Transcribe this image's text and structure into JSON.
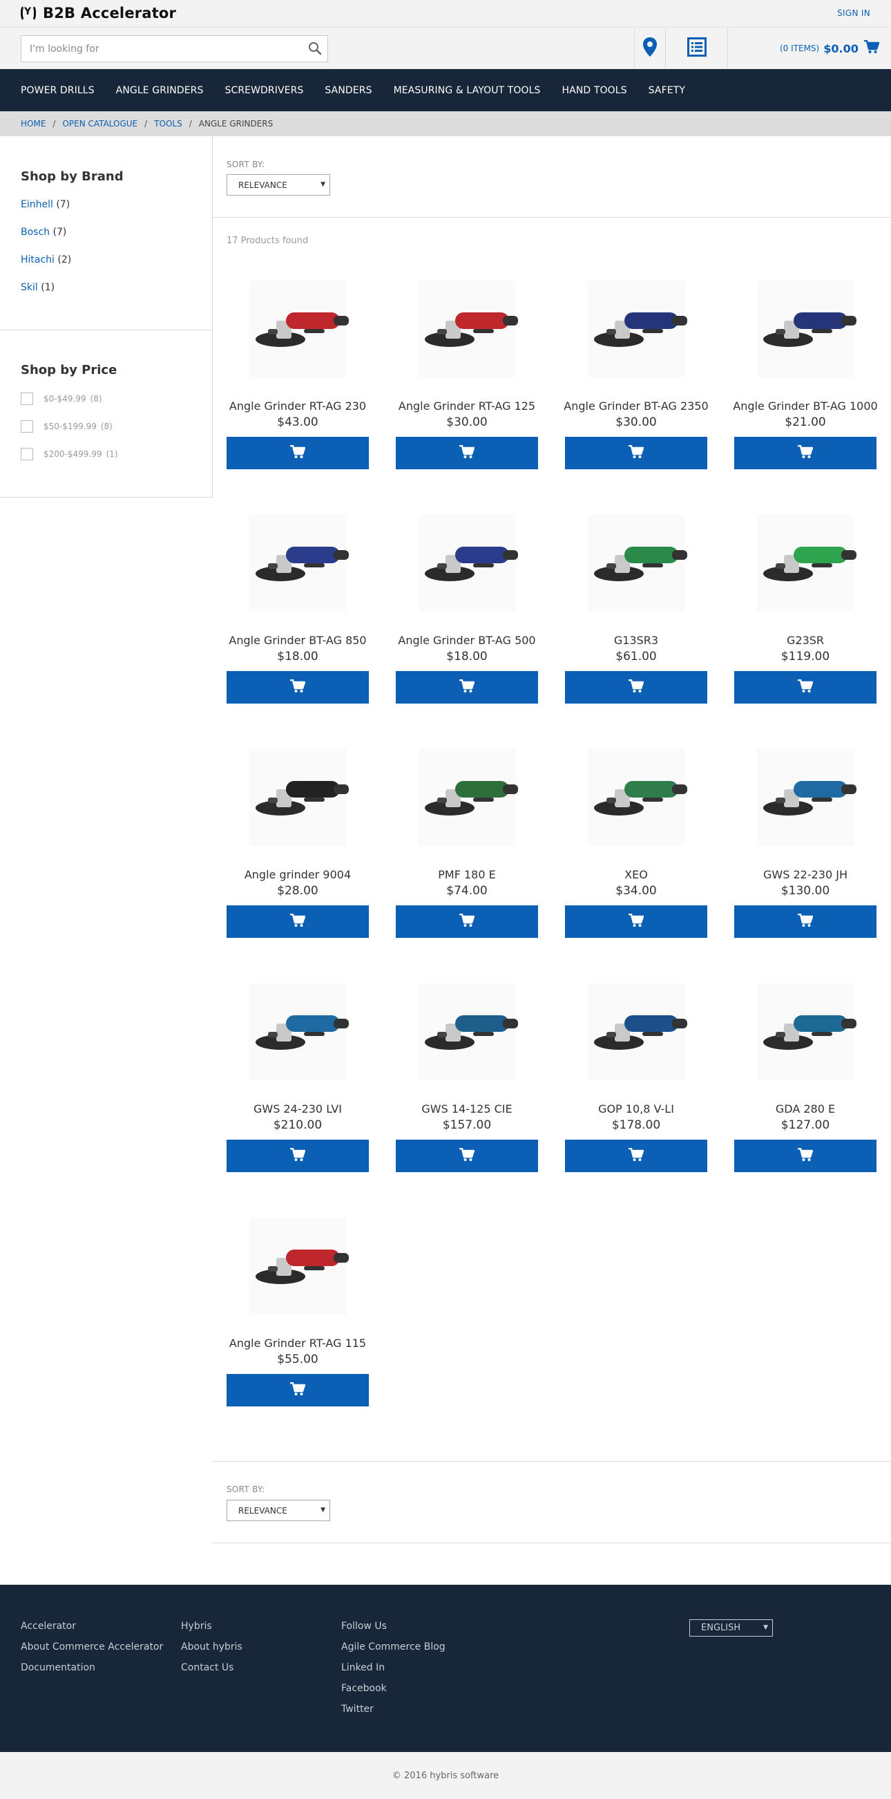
{
  "header": {
    "logo_text": "B2B Accelerator",
    "signin": "SIGN IN",
    "search_placeholder": "I'm looking for",
    "cart_items": "(0 ITEMS)",
    "cart_total": "$0.00"
  },
  "nav": {
    "items": [
      "POWER DRILLS",
      "ANGLE GRINDERS",
      "SCREWDRIVERS",
      "SANDERS",
      "MEASURING & LAYOUT TOOLS",
      "HAND TOOLS",
      "SAFETY"
    ]
  },
  "breadcrumb": {
    "home": "HOME",
    "catalogue": "OPEN CATALOGUE",
    "tools": "TOOLS",
    "current": "ANGLE GRINDERS",
    "separator": "/"
  },
  "sidebar": {
    "brand_title": "Shop by Brand",
    "brands": [
      {
        "name": "Einhell",
        "count": "(7)"
      },
      {
        "name": "Bosch",
        "count": "(7)"
      },
      {
        "name": "Hitachi",
        "count": "(2)"
      },
      {
        "name": "Skil",
        "count": "(1)"
      }
    ],
    "price_title": "Shop by Price",
    "prices": [
      {
        "range": "$0-$49.99",
        "count": "(8)"
      },
      {
        "range": "$50-$199.99",
        "count": "(8)"
      },
      {
        "range": "$200-$499.99",
        "count": "(1)"
      }
    ]
  },
  "listing": {
    "sort_label": "SORT BY:",
    "sort_value": "RELEVANCE",
    "found": "17 Products found"
  },
  "products": [
    {
      "name": "Angle Grinder RT-AG 230",
      "price": "$43.00",
      "color": "#c0272d"
    },
    {
      "name": "Angle Grinder RT-AG 125",
      "price": "$30.00",
      "color": "#c0272d"
    },
    {
      "name": "Angle Grinder BT-AG 2350",
      "price": "$30.00",
      "color": "#26357a"
    },
    {
      "name": "Angle Grinder BT-AG 1000",
      "price": "$21.00",
      "color": "#26357a"
    },
    {
      "name": "Angle Grinder BT-AG 850",
      "price": "$18.00",
      "color": "#2b3c8c"
    },
    {
      "name": "Angle Grinder BT-AG 500",
      "price": "$18.00",
      "color": "#2b3c8c"
    },
    {
      "name": "G13SR3",
      "price": "$61.00",
      "color": "#2a8a4a"
    },
    {
      "name": "G23SR",
      "price": "$119.00",
      "color": "#2fa44f"
    },
    {
      "name": "Angle grinder 9004",
      "price": "$28.00",
      "color": "#222222"
    },
    {
      "name": "PMF 180 E",
      "price": "$74.00",
      "color": "#2e6e3a"
    },
    {
      "name": "XEO",
      "price": "$34.00",
      "color": "#2e7d4a"
    },
    {
      "name": "GWS 22-230 JH",
      "price": "$130.00",
      "color": "#1f6aa3"
    },
    {
      "name": "GWS 24-230 LVI",
      "price": "$210.00",
      "color": "#1f6aa3"
    },
    {
      "name": "GWS 14-125 CIE",
      "price": "$157.00",
      "color": "#1d5f8a"
    },
    {
      "name": "GOP 10,8 V-LI",
      "price": "$178.00",
      "color": "#1d4f8a"
    },
    {
      "name": "GDA 280 E",
      "price": "$127.00",
      "color": "#1d6a95"
    },
    {
      "name": "Angle Grinder RT-AG 115",
      "price": "$55.00",
      "color": "#c0272d"
    }
  ],
  "footer": {
    "col1": [
      "Accelerator",
      "About Commerce Accelerator",
      "Documentation"
    ],
    "col2": [
      "Hybris",
      "About hybris",
      "Contact Us"
    ],
    "col3": [
      "Follow Us",
      "Agile Commerce Blog",
      "Linked In",
      "Facebook",
      "Twitter"
    ],
    "language": "ENGLISH",
    "copyright": "© 2016 hybris software"
  },
  "colors": {
    "brand_blue": "#0b5fb4",
    "nav_bg": "#172638",
    "footer_bg": "#172638"
  }
}
